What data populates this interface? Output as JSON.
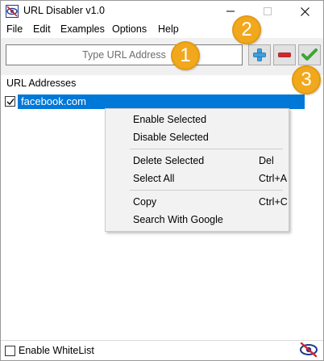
{
  "window": {
    "title": "URL Disabler v1.0"
  },
  "menu": {
    "items": [
      "File",
      "Edit",
      "Examples",
      "Options",
      "Help"
    ]
  },
  "toolbar": {
    "url_placeholder": "Type URL Address",
    "add_icon": "plus-icon",
    "remove_icon": "minus-icon",
    "apply_icon": "checkmark-icon",
    "add_color": "#3aa0e0",
    "remove_color": "#d9232a",
    "apply_color": "#3fa535"
  },
  "list": {
    "header": "URL Addresses",
    "items": [
      {
        "label": "facebook.com",
        "checked": true,
        "selected": true
      }
    ],
    "selection_color": "#0078d7"
  },
  "context_menu": {
    "items": [
      {
        "label": "Enable Selected",
        "shortcut": ""
      },
      {
        "label": "Disable Selected",
        "shortcut": ""
      },
      {
        "label": "Delete Selected",
        "shortcut": "Del"
      },
      {
        "label": "Select All",
        "shortcut": "Ctrl+A"
      },
      {
        "label": "Copy",
        "shortcut": "Ctrl+C"
      },
      {
        "label": "Search With Google",
        "shortcut": ""
      }
    ]
  },
  "footer": {
    "whitelist_label": "Enable WhiteList",
    "whitelist_checked": false
  },
  "callouts": [
    "1",
    "2",
    "3"
  ],
  "callout_color": "#f2a81d"
}
